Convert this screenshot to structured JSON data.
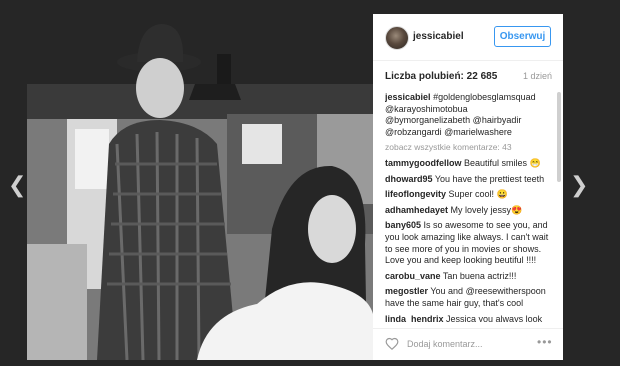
{
  "nav": {
    "prev_icon": "chevron-left-icon",
    "next_icon": "chevron-right-icon",
    "prev_glyph": "❮",
    "next_glyph": "❯"
  },
  "post": {
    "username": "jessicabiel",
    "follow_label": "Obserwuj",
    "likes_label": "Liczba polubień: 22 685",
    "time_ago": "1 dzień",
    "view_all_label": "zobacz wszystkie komentarze: 43",
    "caption": {
      "user": "jessicabiel",
      "text": "#goldenglobesglamsquad @karayoshimotobua @bymorganelizabeth @hairbyadir @robzangardi @marielwashere"
    },
    "comments": [
      {
        "user": "tammygoodfellow",
        "text": "Beautiful smiles 😁"
      },
      {
        "user": "dhoward95",
        "text": "You have the prettiest teeth"
      },
      {
        "user": "lifeoflongevity",
        "text": "Super cool! 😀"
      },
      {
        "user": "adhamhedayet",
        "text": "My lovely jessy😍"
      },
      {
        "user": "bany605",
        "text": "Is so awesome to see you, and you look amazing like always. I can't wait to see more of you in movies or shows. Love you and keep looking beutiful !!!!"
      },
      {
        "user": "carobu_vane",
        "text": "Tan buena actriz!!!"
      },
      {
        "user": "megostler",
        "text": "You and @reesewitherspoon have the same hair guy, that's cool"
      },
      {
        "user": "linda_hendrix",
        "text": "Jessica you always look so gorgeous"
      }
    ],
    "add_comment_placeholder": "Dodaj komentarz...",
    "more_options": "•••",
    "like_icon": "heart-icon",
    "photo_icon": "photo"
  }
}
